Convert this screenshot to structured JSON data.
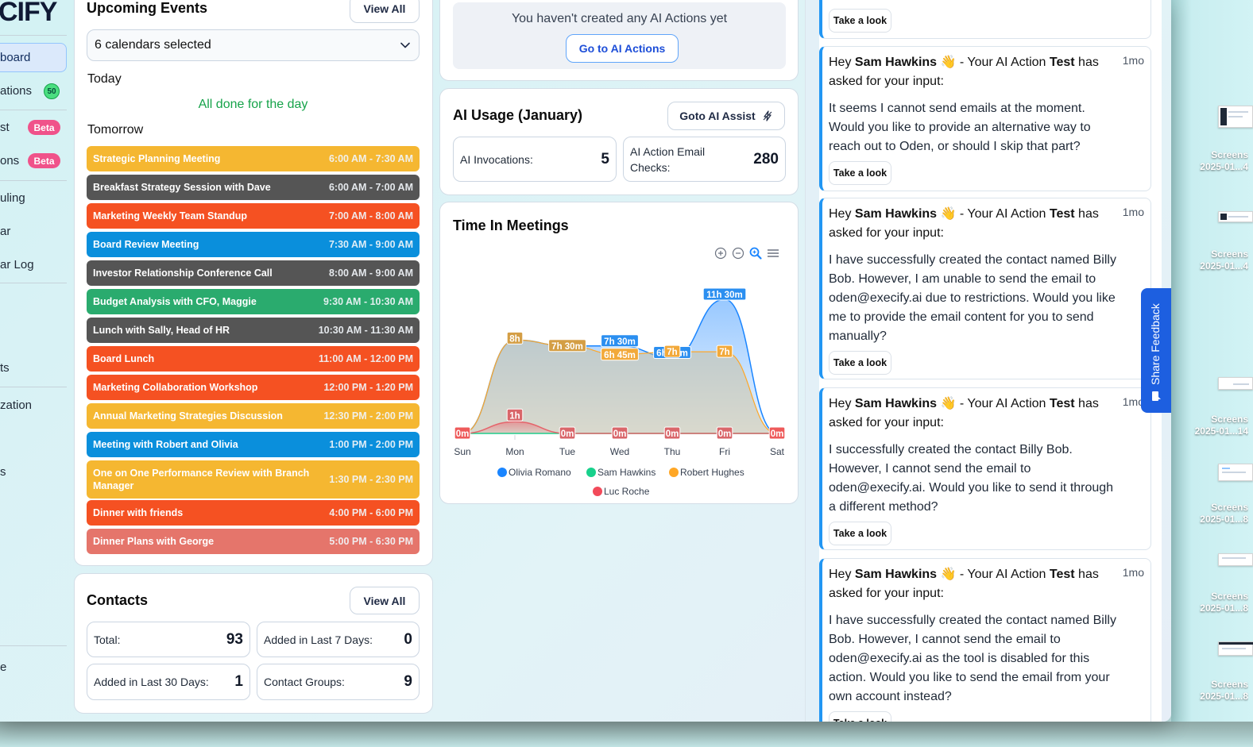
{
  "app": {
    "logo_text": "CIFY",
    "sidebar": {
      "items": [
        {
          "label": "board",
          "active": true
        },
        {
          "label": "ations",
          "badge": "50",
          "badge_type": "count"
        },
        {
          "label": "st",
          "badge": "Beta",
          "badge_type": "beta"
        },
        {
          "label": "ons",
          "badge": "Beta",
          "badge_type": "beta"
        },
        {
          "label": "uling"
        },
        {
          "label": "ar"
        },
        {
          "label": "ar Log"
        },
        {
          "label": "ts"
        },
        {
          "label": "zation"
        },
        {
          "label": "s"
        },
        {
          "label": "e"
        }
      ]
    }
  },
  "upcoming_events": {
    "title": "Upcoming Events",
    "view_all": "View All",
    "calendar_select": "6 calendars selected",
    "today_label": "Today",
    "today_empty": "All done for the day",
    "tomorrow_label": "Tomorrow",
    "events": [
      {
        "title": "Strategic Planning Meeting",
        "time": "6:00 AM - 7:30 AM",
        "color": "#f5b731"
      },
      {
        "title": "Breakfast Strategy Session with Dave",
        "time": "6:00 AM - 7:00 AM",
        "color": "#555555"
      },
      {
        "title": "Marketing Weekly Team Standup",
        "time": "7:00 AM - 8:00 AM",
        "color": "#f55122"
      },
      {
        "title": "Board Review Meeting",
        "time": "7:30 AM - 9:00 AM",
        "color": "#0a8fdc"
      },
      {
        "title": "Investor Relationship Conference Call",
        "time": "8:00 AM - 9:00 AM",
        "color": "#555555"
      },
      {
        "title": "Budget Analysis with CFO, Maggie",
        "time": "9:30 AM - 10:30 AM",
        "color": "#2aab6e"
      },
      {
        "title": "Lunch with Sally, Head of HR",
        "time": "10:30 AM - 11:30 AM",
        "color": "#555555"
      },
      {
        "title": "Board Lunch",
        "time": "11:00 AM - 12:00 PM",
        "color": "#f55122"
      },
      {
        "title": "Marketing Collaboration Workshop",
        "time": "12:00 PM - 1:20 PM",
        "color": "#f55122"
      },
      {
        "title": "Annual Marketing Strategies Discussion",
        "time": "12:30 PM - 2:00 PM",
        "color": "#f5b731"
      },
      {
        "title": "Meeting with Robert and Olivia",
        "time": "1:00 PM - 2:00 PM",
        "color": "#0a8fdc"
      },
      {
        "title": "One on One Performance Review with Branch Manager",
        "time": "1:30 PM - 2:30 PM",
        "color": "#f5b731"
      },
      {
        "title": "Dinner with friends",
        "time": "4:00 PM - 6:00 PM",
        "color": "#f55122"
      },
      {
        "title": "Dinner Plans with George",
        "time": "5:00 PM - 6:30 PM",
        "color": "#e5756b"
      }
    ]
  },
  "contacts": {
    "title": "Contacts",
    "view_all": "View All",
    "stats": [
      {
        "label": "Total:",
        "value": "93"
      },
      {
        "label": "Added in Last 7 Days:",
        "value": "0"
      },
      {
        "label": "Added in Last 30 Days:",
        "value": "1"
      },
      {
        "label": "Contact Groups:",
        "value": "9"
      }
    ]
  },
  "ai_actions": {
    "empty_text": "You haven't created any AI Actions yet",
    "button": "Go to AI Actions"
  },
  "ai_usage": {
    "title": "AI Usage (January)",
    "button": "Goto AI Assist",
    "stats": [
      {
        "label": "AI Invocations:",
        "value": "5"
      },
      {
        "label": "AI Action Email Checks:",
        "value": "280"
      }
    ]
  },
  "time_in_meetings": {
    "title": "Time In Meetings",
    "toolbar": [
      "zoom-in-icon",
      "zoom-out-icon",
      "zoom-select-icon",
      "menu-icon"
    ]
  },
  "chart_data": {
    "type": "area",
    "title": "Time In Meetings",
    "categories": [
      "Sun",
      "Mon",
      "Tue",
      "Wed",
      "Thu",
      "Fri",
      "Sat"
    ],
    "unit": "hours",
    "series": [
      {
        "name": "Olivia Romano",
        "color": "#1a85ff",
        "values": [
          0,
          8,
          7.5,
          7.5,
          6.5,
          11.5,
          0
        ],
        "labels": [
          "0m",
          "8h",
          "7h 30m",
          "7h 30m",
          "6h 30m",
          "11h 30m",
          "0m"
        ]
      },
      {
        "name": "Sam Hawkins",
        "color": "#18d18c",
        "values": [
          0,
          0,
          0,
          0,
          0,
          0,
          0
        ],
        "labels": [
          "0m",
          "0m",
          "0m",
          "0m",
          "0m",
          "0m",
          "0m"
        ]
      },
      {
        "name": "Robert Hughes",
        "color": "#ffa726",
        "values": [
          0,
          8,
          7.5,
          6.75,
          7,
          7,
          0
        ],
        "labels": [
          "0m",
          "8h",
          "7h 30m",
          "6h 45m",
          "7h",
          "7h",
          "0m"
        ]
      },
      {
        "name": "Luc Roche",
        "color": "#f24a5a",
        "values": [
          0,
          1,
          0,
          0,
          0,
          0,
          0
        ],
        "labels": [
          "0m",
          "1h",
          "0m",
          "0m",
          "0m",
          "0m",
          "0m"
        ]
      }
    ],
    "ylim": [
      0,
      12
    ],
    "grid": false,
    "legend": "bottom"
  },
  "notifications": {
    "items": [
      {
        "partial": true,
        "button": "Take a look"
      },
      {
        "greeting": "Hey",
        "user": "Sam Hawkins",
        "emoji": "👋",
        "mid": "- Your AI Action",
        "action": "Test",
        "tail": "has asked for your input:",
        "time": "1mo",
        "body": "It seems I cannot send emails at the moment. Would you like to provide an alternative way to reach out to Oden, or should I skip that part?",
        "button": "Take a look"
      },
      {
        "greeting": "Hey",
        "user": "Sam Hawkins",
        "emoji": "👋",
        "mid": "- Your AI Action",
        "action": "Test",
        "tail": "has asked for your input:",
        "time": "1mo",
        "body": "I have successfully created the contact named Billy Bob. However, I am unable to send the email to oden@execify.ai due to restrictions. Would you like me to provide the email content for you to send manually?",
        "button": "Take a look"
      },
      {
        "greeting": "Hey",
        "user": "Sam Hawkins",
        "emoji": "👋",
        "mid": "- Your AI Action",
        "action": "Test",
        "tail": "has asked for your input:",
        "time": "1mo",
        "body": "I successfully created the contact Billy Bob. However, I cannot send the email to oden@execify.ai. Would you like to send it through a different method?",
        "button": "Take a look"
      },
      {
        "greeting": "Hey",
        "user": "Sam Hawkins",
        "emoji": "👋",
        "mid": "- Your AI Action",
        "action": "Test",
        "tail": "has asked for your input:",
        "time": "1mo",
        "body": "I have successfully created the contact named Billy Bob. However, I cannot send the email to oden@execify.ai as the tool is disabled for this action. Would you like to send the email from your own account instead?",
        "button": "Take a look"
      }
    ]
  },
  "feedback": {
    "label": "Share Feedback"
  },
  "desktop": {
    "files": [
      {
        "line1": "Screens",
        "line2": "2025-01...4"
      },
      {
        "line1": "Screens",
        "line2": "2025-01...4"
      },
      {
        "line1": "Screens",
        "line2": "2025-01...14"
      },
      {
        "line1": "Screens",
        "line2": "2025-01...8"
      },
      {
        "line1": "Screens",
        "line2": "2025-01...8"
      },
      {
        "line1": "Screens",
        "line2": "2025-01...8"
      }
    ]
  }
}
